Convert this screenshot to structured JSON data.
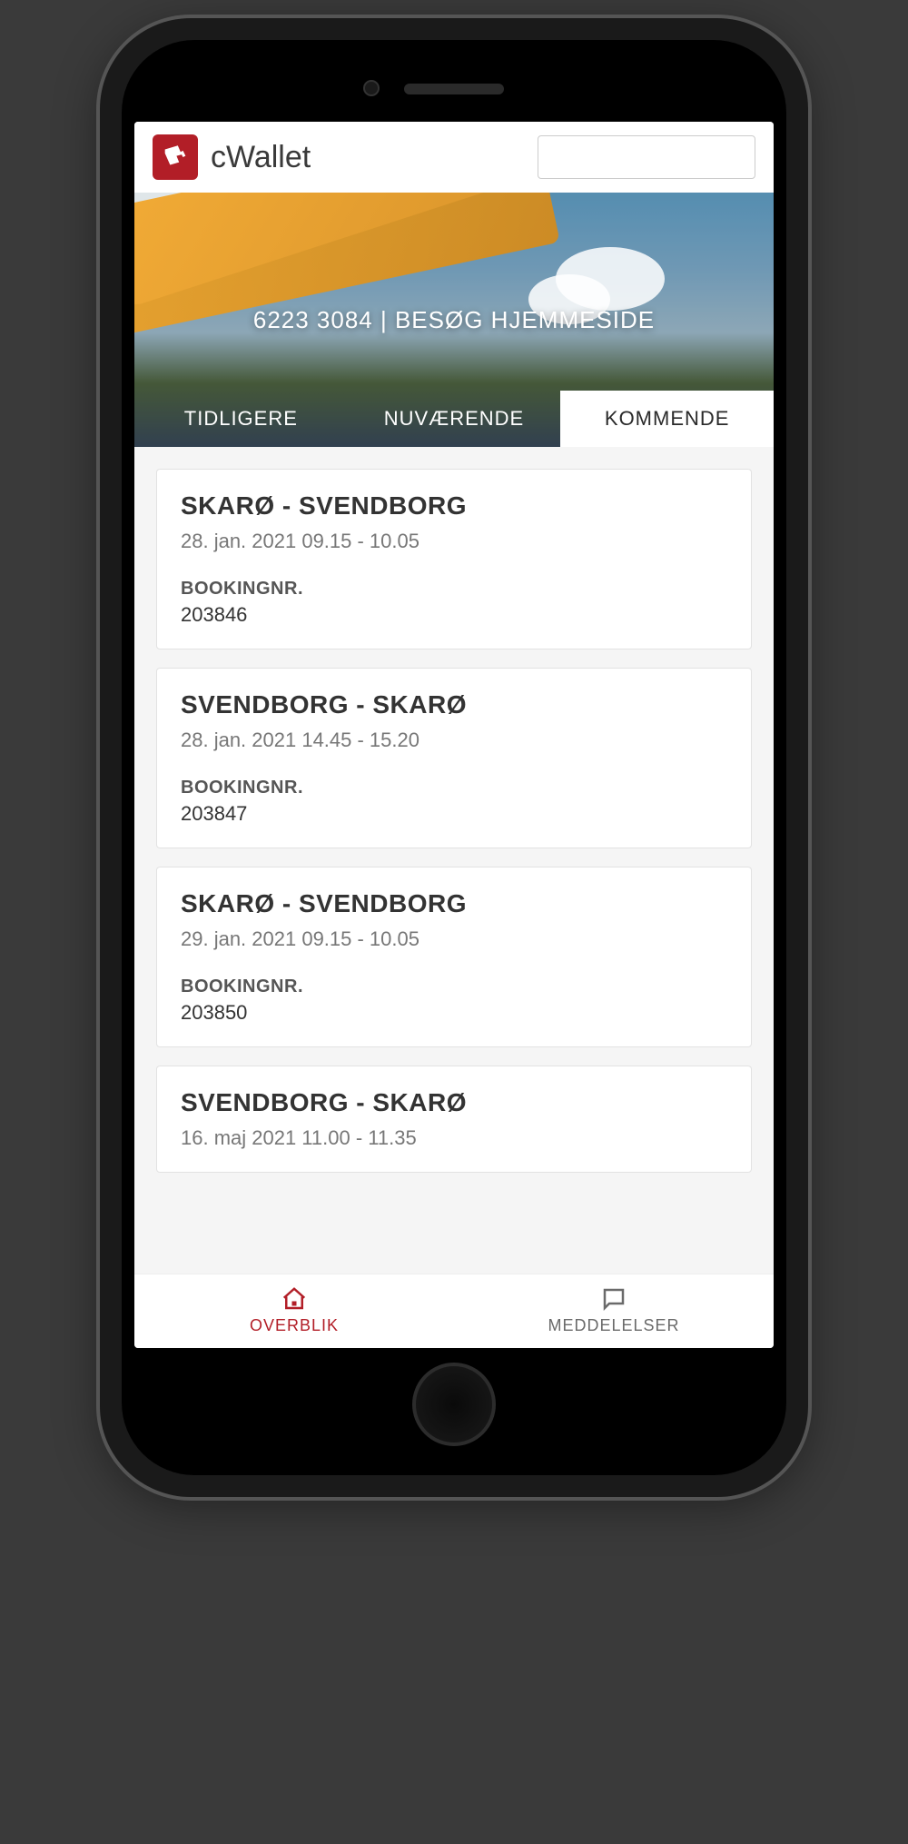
{
  "header": {
    "app_title": "cWallet"
  },
  "banner": {
    "phone": "6223 3084",
    "sep": " | ",
    "link": "BESØG HJEMMESIDE"
  },
  "tabs": [
    {
      "label": "TIDLIGERE",
      "active": false
    },
    {
      "label": "NUVÆRENDE",
      "active": false
    },
    {
      "label": "KOMMENDE",
      "active": true
    }
  ],
  "booking_label": "BOOKINGNR.",
  "bookings": [
    {
      "route": "SKARØ - SVENDBORG",
      "date": "28. jan. 2021 09.15 - 10.05",
      "nr": "203846"
    },
    {
      "route": "SVENDBORG - SKARØ",
      "date": "28. jan. 2021 14.45 - 15.20",
      "nr": "203847"
    },
    {
      "route": "SKARØ - SVENDBORG",
      "date": "29. jan. 2021 09.15 - 10.05",
      "nr": "203850"
    },
    {
      "route": "SVENDBORG - SKARØ",
      "date": "16. maj 2021 11.00 - 11.35",
      "nr": ""
    }
  ],
  "bottom_nav": {
    "overview": "OVERBLIK",
    "messages": "MEDDELELSER"
  },
  "colors": {
    "brand": "#b21e27"
  }
}
